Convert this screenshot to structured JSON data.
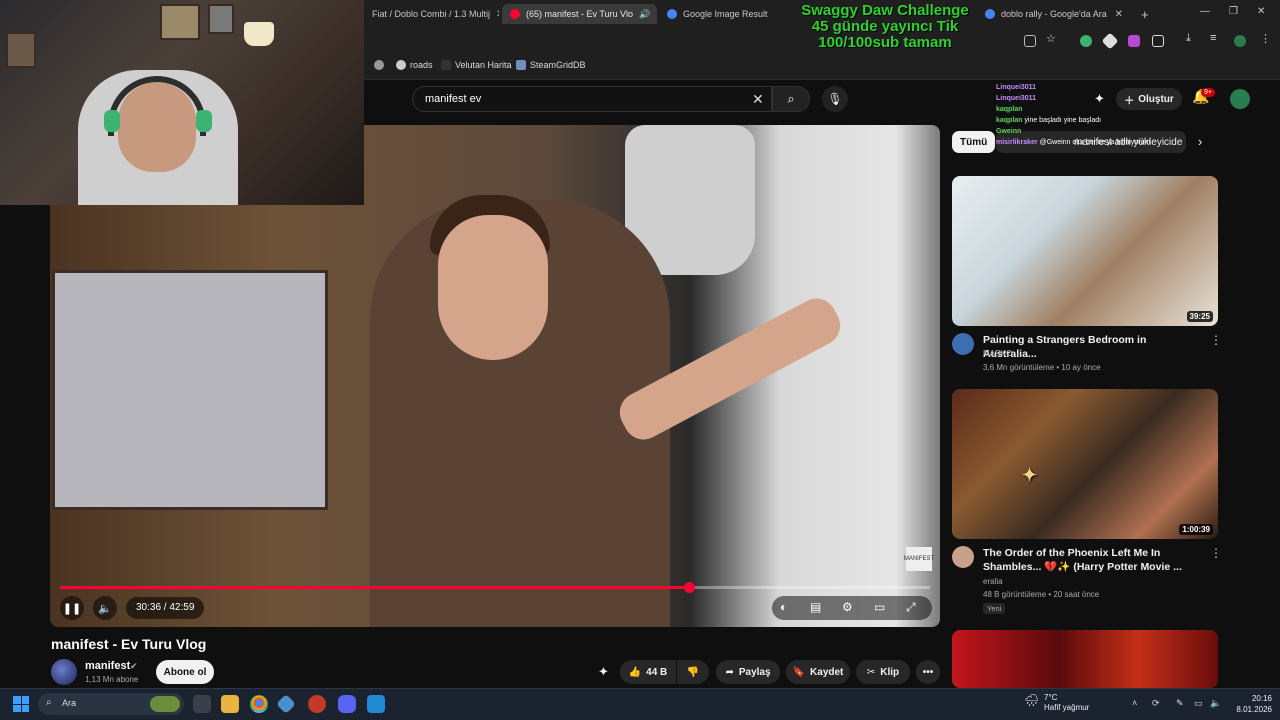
{
  "browser": {
    "tabs": [
      {
        "label": "Fiat / Doblo Combi / 1.3 Multij",
        "active": false
      },
      {
        "label": "(65) manifest - Ev Turu Vlo",
        "active": true
      },
      {
        "label": "Google Image Result",
        "active": false
      },
      {
        "label": "doblo rally - Google'da Ara",
        "active": false
      }
    ],
    "new_tab": "+",
    "bookmarks": [
      "roads",
      "Velutan Harita",
      "SteamGridDB"
    ]
  },
  "stream_overlay": {
    "line1": "Swaggy Daw Challenge",
    "line2": "45 günde yayıncı Tik",
    "line3": "100/100sub tamam"
  },
  "youtube": {
    "search_value": "manifest ev",
    "create_label": "Oluştur",
    "notif_badge": "9+",
    "chips": [
      "Tümü",
      "manifest adlı yükleyicide"
    ]
  },
  "player": {
    "time": "30:36 / 42:59",
    "progress_fraction": 0.723,
    "watermark": "MANIFEST"
  },
  "video": {
    "title": "manifest - Ev Turu Vlog",
    "channel": "manifest",
    "subs": "1,13 Mn abone",
    "subscribe": "Abone ol",
    "likes": "44 B",
    "share": "Paylaş",
    "save": "Kaydet",
    "clip": "Klip",
    "more": "•••"
  },
  "recommended": [
    {
      "duration": "39:25",
      "title": "Painting a Strangers Bedroom in Australia...",
      "channel": "MARKO",
      "meta": "3,6 Mn görüntüleme • 10 ay önce",
      "new": ""
    },
    {
      "duration": "1:00:39",
      "title": "The Order of the Phoenix Left Me In Shambles... 💔✨ (Harry Potter Movie ...",
      "channel": "eralia",
      "meta": "48 B görüntüleme • 20 saat önce",
      "new": "Yeni"
    }
  ],
  "chat": [
    {
      "user": "Linquei3011",
      "msg": "",
      "color": "#c58cff"
    },
    {
      "user": "Linquei3011",
      "msg": "",
      "color": "#c58cff"
    },
    {
      "user": "kaqplan",
      "msg": "",
      "color": "#5fd35f"
    },
    {
      "user": "kaqplan",
      "msg": "yine başladı yine başladı",
      "color": "#5fd35f"
    },
    {
      "user": "Gweinn",
      "msg": "",
      "color": "#5fd35f"
    },
    {
      "user": "misirlikraker",
      "msg": "@Gweinn olur bence ya bilmiyorum",
      "color": "#c58cff"
    }
  ],
  "taskbar": {
    "search": "Ara",
    "temp": "7°C",
    "weather": "Hafif yağmur",
    "time": "20:16",
    "date": "8.01.2026"
  },
  "colors": {
    "accent": "#ff0033",
    "overlay": "#2fd12f"
  }
}
